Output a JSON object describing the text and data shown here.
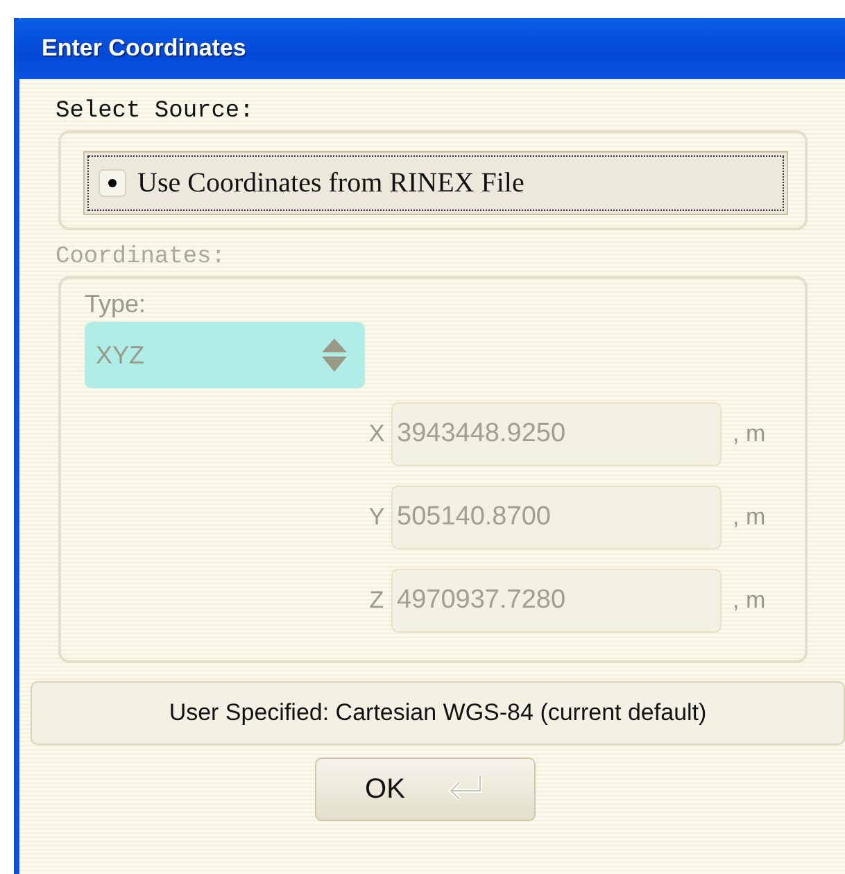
{
  "window": {
    "title": "Enter Coordinates"
  },
  "source": {
    "label": "Select Source:",
    "option": {
      "label": "Use Coordinates from RINEX File",
      "selected": true
    }
  },
  "coordinates": {
    "label": "Coordinates:",
    "disabled": true,
    "type": {
      "label": "Type:",
      "value": "XYZ"
    },
    "fields": [
      {
        "axis": "X",
        "value": "3943448.9250",
        "unit": ", m"
      },
      {
        "axis": "Y",
        "value": "505140.8700",
        "unit": ", m"
      },
      {
        "axis": "Z",
        "value": "4970937.7280",
        "unit": ", m"
      }
    ]
  },
  "status_button": {
    "label": "User Specified: Cartesian WGS-84 (current default)"
  },
  "ok_button": {
    "label": "OK"
  }
}
